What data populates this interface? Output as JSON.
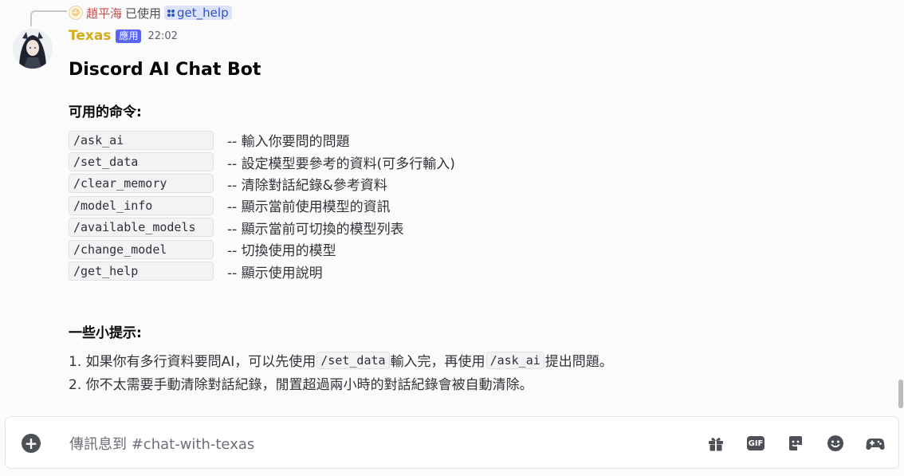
{
  "reply": {
    "user": "趙平海",
    "action": "已使用",
    "command": "get_help"
  },
  "message": {
    "author": "Texas",
    "badge": "應用",
    "timestamp": "22:02",
    "title": "Discord AI Chat Bot",
    "commands_heading": "可用的命令:",
    "commands": [
      {
        "cmd": "/ask_ai",
        "desc": "-- 輸入你要問的問題"
      },
      {
        "cmd": "/set_data",
        "desc": "-- 設定模型要參考的資料(可多行輸入)"
      },
      {
        "cmd": "/clear_memory",
        "desc": "-- 清除對話紀錄&參考資料"
      },
      {
        "cmd": "/model_info",
        "desc": "-- 顯示當前使用模型的資訊"
      },
      {
        "cmd": "/available_models",
        "desc": "-- 顯示當前可切換的模型列表"
      },
      {
        "cmd": "/change_model",
        "desc": "-- 切換使用的模型"
      },
      {
        "cmd": "/get_help",
        "desc": "-- 顯示使用說明"
      }
    ],
    "tips_heading": "一些小提示:",
    "tip1": {
      "prefix": "1. 如果你有多行資料要問AI，可以先使用",
      "code1": "/set_data",
      "middle": "輸入完，再使用",
      "code2": "/ask_ai",
      "suffix": "提出問題。"
    },
    "tip2": "2. 你不太需要手動清除對話紀錄，閒置超過兩小時的對話紀錄會被自動清除。"
  },
  "composer": {
    "placeholder": "傳訊息到 #chat-with-texas",
    "value": "",
    "gif_label": "GIF",
    "icons": [
      "add-icon",
      "gift-icon",
      "gif-icon",
      "sticker-icon",
      "emoji-icon",
      "gamepad-icon"
    ]
  },
  "colors": {
    "background": "#fbfbfc",
    "author": "#d4ab12",
    "badge": "#5865f2",
    "reply_user": "#c0504d",
    "command_chip": "#dde3fb"
  }
}
